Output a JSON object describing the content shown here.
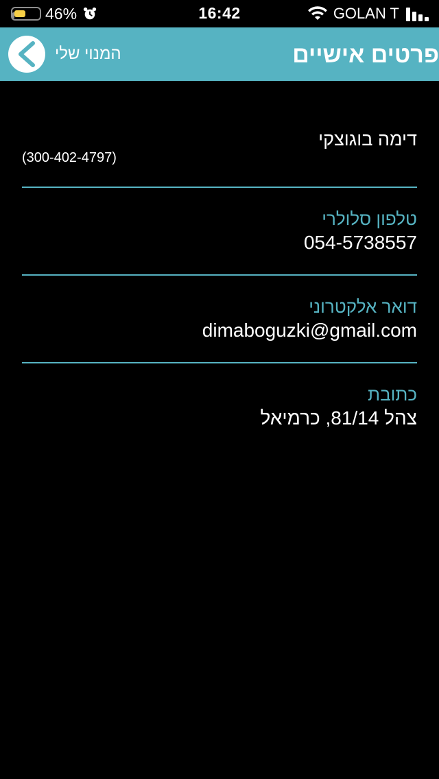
{
  "status_bar": {
    "battery_percent": "46%",
    "battery_level": 0.46,
    "time": "16:42",
    "carrier": "GOLAN T",
    "battery_color": "#f7cf46"
  },
  "nav": {
    "back_label": "המנוי שלי",
    "title": "פרטים אישיים",
    "bar_color": "#56b3c2"
  },
  "profile": {
    "name": "דימה בוגוצקי",
    "id": "(300-402-4797)"
  },
  "fields": [
    {
      "label": "טלפון סלולרי",
      "value": "054-5738557"
    },
    {
      "label": "דואר אלקטרוני",
      "value": "dimaboguzki@gmail.com"
    },
    {
      "label": "כתובת",
      "value": "צהל 81/14, כרמיאל"
    }
  ]
}
